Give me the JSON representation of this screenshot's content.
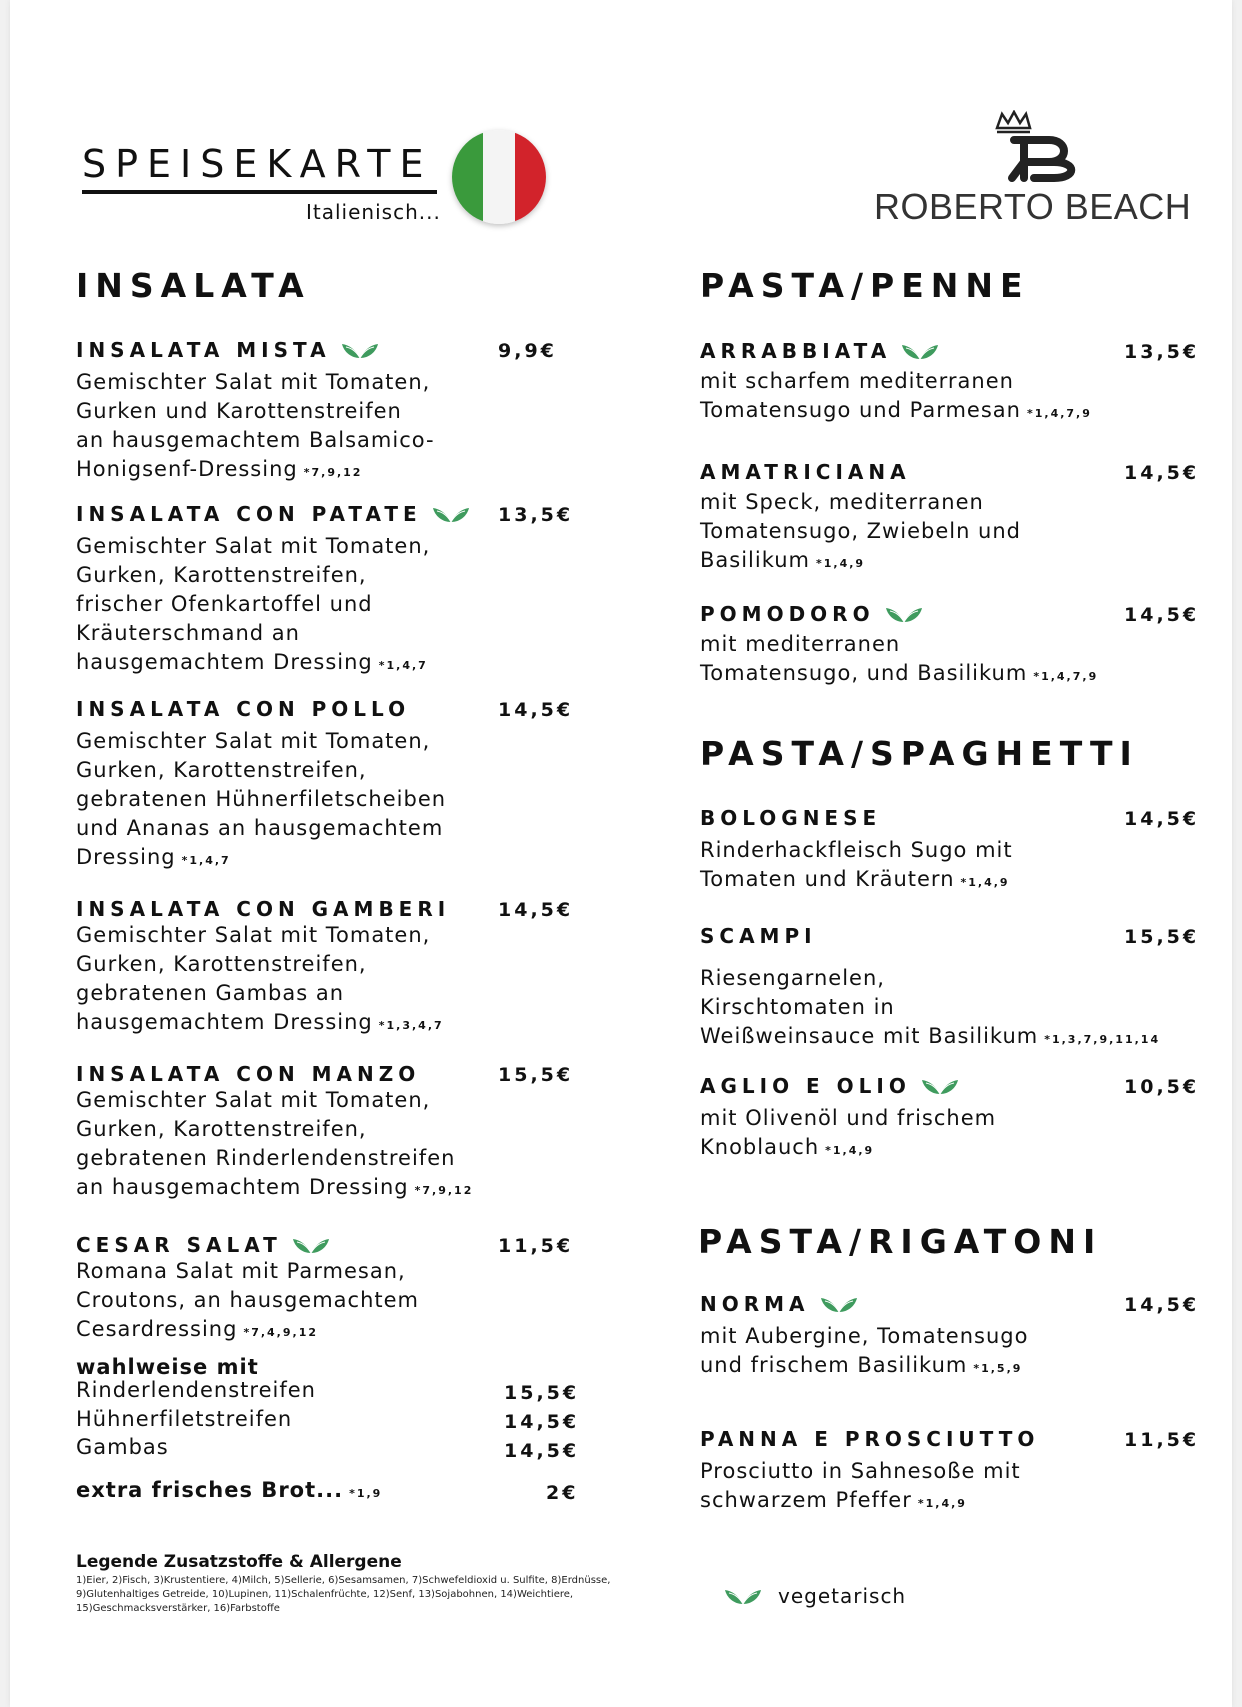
{
  "header": {
    "title": "SPEISEKARTE",
    "subtitle": "Italienisch...",
    "brand": "ROBERTO BEACH"
  },
  "colors": {
    "flag_green": "#3a9a3c",
    "flag_white": "#f4f4f4",
    "flag_red": "#d2232b",
    "leaf_green": "#3f9b5e"
  },
  "insalata": {
    "title": "INSALATA",
    "items": [
      {
        "name": "INSALATA MISTA",
        "price": "9,9€",
        "veg": true,
        "lines": [
          "Gemischter Salat mit Tomaten,",
          "Gurken und Karottenstreifen",
          "an hausgemachtem Balsamico-",
          "Honigsenf-Dressing"
        ],
        "allergens": "*7,9,12"
      },
      {
        "name": "INSALATA CON PATATE",
        "price": "13,5€",
        "veg": true,
        "lines": [
          "Gemischter Salat mit Tomaten,",
          "Gurken, Karottenstreifen,",
          "frischer Ofenkartoffel und",
          "Kräuterschmand an",
          "hausgemachtem Dressing"
        ],
        "allergens": "*1,4,7"
      },
      {
        "name": "INSALATA CON POLLO",
        "price": "14,5€",
        "veg": false,
        "lines": [
          "Gemischter Salat mit Tomaten,",
          "Gurken, Karottenstreifen,",
          "gebratenen Hühnerfiletscheiben",
          "und Ananas an hausgemachtem",
          "Dressing"
        ],
        "allergens": "*1,4,7"
      },
      {
        "name": "INSALATA CON GAMBERI",
        "price": "14,5€",
        "veg": false,
        "lines": [
          "Gemischter Salat mit Tomaten,",
          "Gurken, Karottenstreifen,",
          "gebratenen Gambas an",
          "hausgemachtem Dressing"
        ],
        "allergens": "*1,3,4,7"
      },
      {
        "name": "INSALATA CON MANZO",
        "price": "15,5€",
        "veg": false,
        "lines": [
          "Gemischter Salat mit Tomaten,",
          "Gurken, Karottenstreifen,",
          "gebratenen Rinderlendenstreifen",
          "an hausgemachtem Dressing"
        ],
        "allergens": "*7,9,12"
      },
      {
        "name": "CESAR SALAT",
        "price": "11,5€",
        "veg": true,
        "lines": [
          "Romana Salat mit Parmesan,",
          "Croutons, an hausgemachtem",
          "Cesardressing"
        ],
        "allergens": "*7,4,9,12"
      }
    ],
    "options": {
      "heading": "wahlweise mit",
      "items": [
        {
          "label": "Rinderlendenstreifen",
          "price": "15,5€"
        },
        {
          "label": "Hühnerfiletstreifen",
          "price": "14,5€"
        },
        {
          "label": "Gambas",
          "price": "14,5€"
        }
      ]
    },
    "extra": {
      "label": "extra frisches Brot...",
      "allergens": "*1,9",
      "price": "2€"
    }
  },
  "pasta_penne": {
    "title": "PASTA/PENNE",
    "items": [
      {
        "name": "ARRABBIATA",
        "price": "13,5€",
        "veg": true,
        "lines": [
          "mit scharfem mediterranen",
          "Tomatensugo und Parmesan"
        ],
        "allergens": "*1,4,7,9"
      },
      {
        "name": "AMATRICIANA",
        "price": "14,5€",
        "veg": false,
        "lines": [
          "mit Speck, mediterranen",
          "Tomatensugo, Zwiebeln und",
          "Basilikum"
        ],
        "allergens": "*1,4,9"
      },
      {
        "name": "POMODORO",
        "price": "14,5€",
        "veg": true,
        "lines": [
          "mit mediterranen",
          "Tomatensugo, und Basilikum"
        ],
        "allergens": "*1,4,7,9"
      }
    ]
  },
  "pasta_spaghetti": {
    "title": "PASTA/SPAGHETTI",
    "items": [
      {
        "name": "BOLOGNESE",
        "price": "14,5€",
        "veg": false,
        "lines": [
          "Rinderhackfleisch Sugo mit",
          "Tomaten und Kräutern"
        ],
        "allergens": "*1,4,9"
      },
      {
        "name": "SCAMPI",
        "price": "15,5€",
        "veg": false,
        "lines": [
          "Riesengarnelen,",
          "Kirschtomaten in",
          "Weißweinsauce mit Basilikum"
        ],
        "allergens": "*1,3,7,9,11,14"
      },
      {
        "name": "AGLIO E OLIO",
        "price": "10,5€",
        "veg": true,
        "lines": [
          "mit Olivenöl und frischem",
          "Knoblauch"
        ],
        "allergens": "*1,4,9"
      }
    ]
  },
  "pasta_rigatoni": {
    "title": "PASTA/RIGATONI",
    "items": [
      {
        "name": "NORMA",
        "price": "14,5€",
        "veg": true,
        "lines": [
          "mit Aubergine, Tomatensugo",
          "und frischem Basilikum"
        ],
        "allergens": "*1,5,9"
      },
      {
        "name": "PANNA E PROSCIUTTO",
        "price": "11,5€",
        "veg": false,
        "lines": [
          "Prosciutto in Sahnesoße mit",
          "schwarzem Pfeffer"
        ],
        "allergens": "*1,4,9"
      }
    ]
  },
  "legend": {
    "title": "Legende Zusatzstoffe & Allergene",
    "lines": [
      "1)Eier, 2)Fisch, 3)Krustentiere, 4)Milch, 5)Sellerie, 6)Sesamsamen, 7)Schwefeldioxid u. Sulfite, 8)Erdnüsse,",
      "9)Glutenhaltiges Getreide, 10)Lupinen, 11)Schalenfrüchte, 12)Senf, 13)Sojabohnen, 14)Weichtiere,",
      "15)Geschmacksverstärker, 16)Farbstoffe"
    ],
    "veg_label": "vegetarisch"
  }
}
